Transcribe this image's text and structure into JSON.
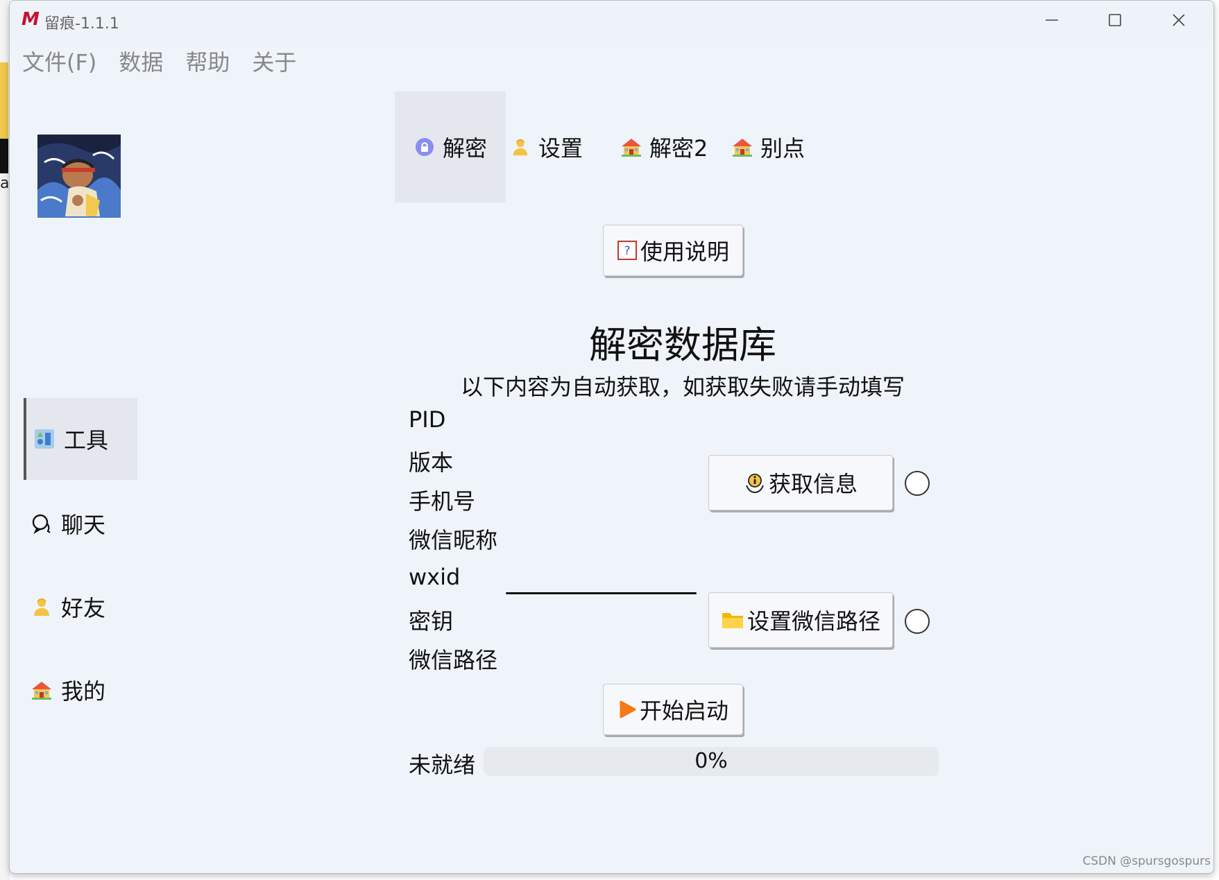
{
  "window": {
    "title": "留痕-1.1.1",
    "logo_letter": "M"
  },
  "menu": [
    "文件(F)",
    "数据",
    "帮助",
    "关于"
  ],
  "sidebar": {
    "items": [
      {
        "label": "工具",
        "icon": "tools-icon"
      },
      {
        "label": "聊天",
        "icon": "chat-icon"
      },
      {
        "label": "好友",
        "icon": "person-icon"
      },
      {
        "label": "我的",
        "icon": "house-icon"
      }
    ],
    "active_index": 0
  },
  "tabs": {
    "items": [
      {
        "label": "解密",
        "icon": "lock-icon"
      },
      {
        "label": "设置",
        "icon": "person-icon"
      },
      {
        "label": "解密2",
        "icon": "house-icon"
      },
      {
        "label": "别点",
        "icon": "house-icon"
      }
    ],
    "active_index": 0
  },
  "main": {
    "help_button": "使用说明",
    "title": "解密数据库",
    "subtitle": "以下内容为自动获取，如获取失败请手动填写",
    "fields": {
      "pid": "PID",
      "version": "版本",
      "phone": "手机号",
      "nickname": "微信昵称",
      "wxid": "wxid",
      "key": "密钥",
      "path": "微信路径"
    },
    "get_info_button": "获取信息",
    "set_path_button": "设置微信路径",
    "start_button": "开始启动",
    "status": "未就绪",
    "progress_text": "0%",
    "progress_value": 0
  },
  "watermark": "CSDN @spursgospurs",
  "colors": {
    "window_bg": "#eff3fa",
    "active_bg": "#e4e8ee",
    "logo": "#c8102e"
  }
}
